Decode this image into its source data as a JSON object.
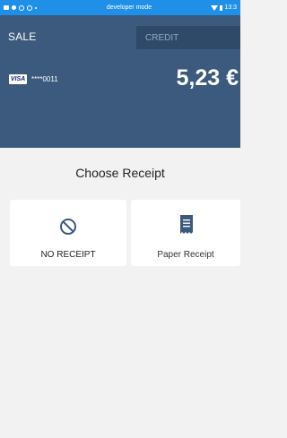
{
  "status_bar": {
    "center_text": "developer mode",
    "time": "13:3"
  },
  "header": {
    "sale_label": "SALE",
    "credit_placeholder": "CREDIT",
    "card_brand": "VISA",
    "card_number": "****0011",
    "amount": "5,23 €"
  },
  "receipt": {
    "title": "Choose Receipt",
    "options": [
      {
        "label": "NO RECEIPT",
        "icon": "no-receipt-icon"
      },
      {
        "label": "Paper Receipt",
        "icon": "paper-receipt-icon"
      }
    ]
  },
  "colors": {
    "status_bar": "#1f8fe8",
    "header_bg": "#3b5a7d",
    "credit_bg": "#2f4a69",
    "page_bg": "#f2f2f2",
    "icon_color": "#3b5a7d"
  }
}
